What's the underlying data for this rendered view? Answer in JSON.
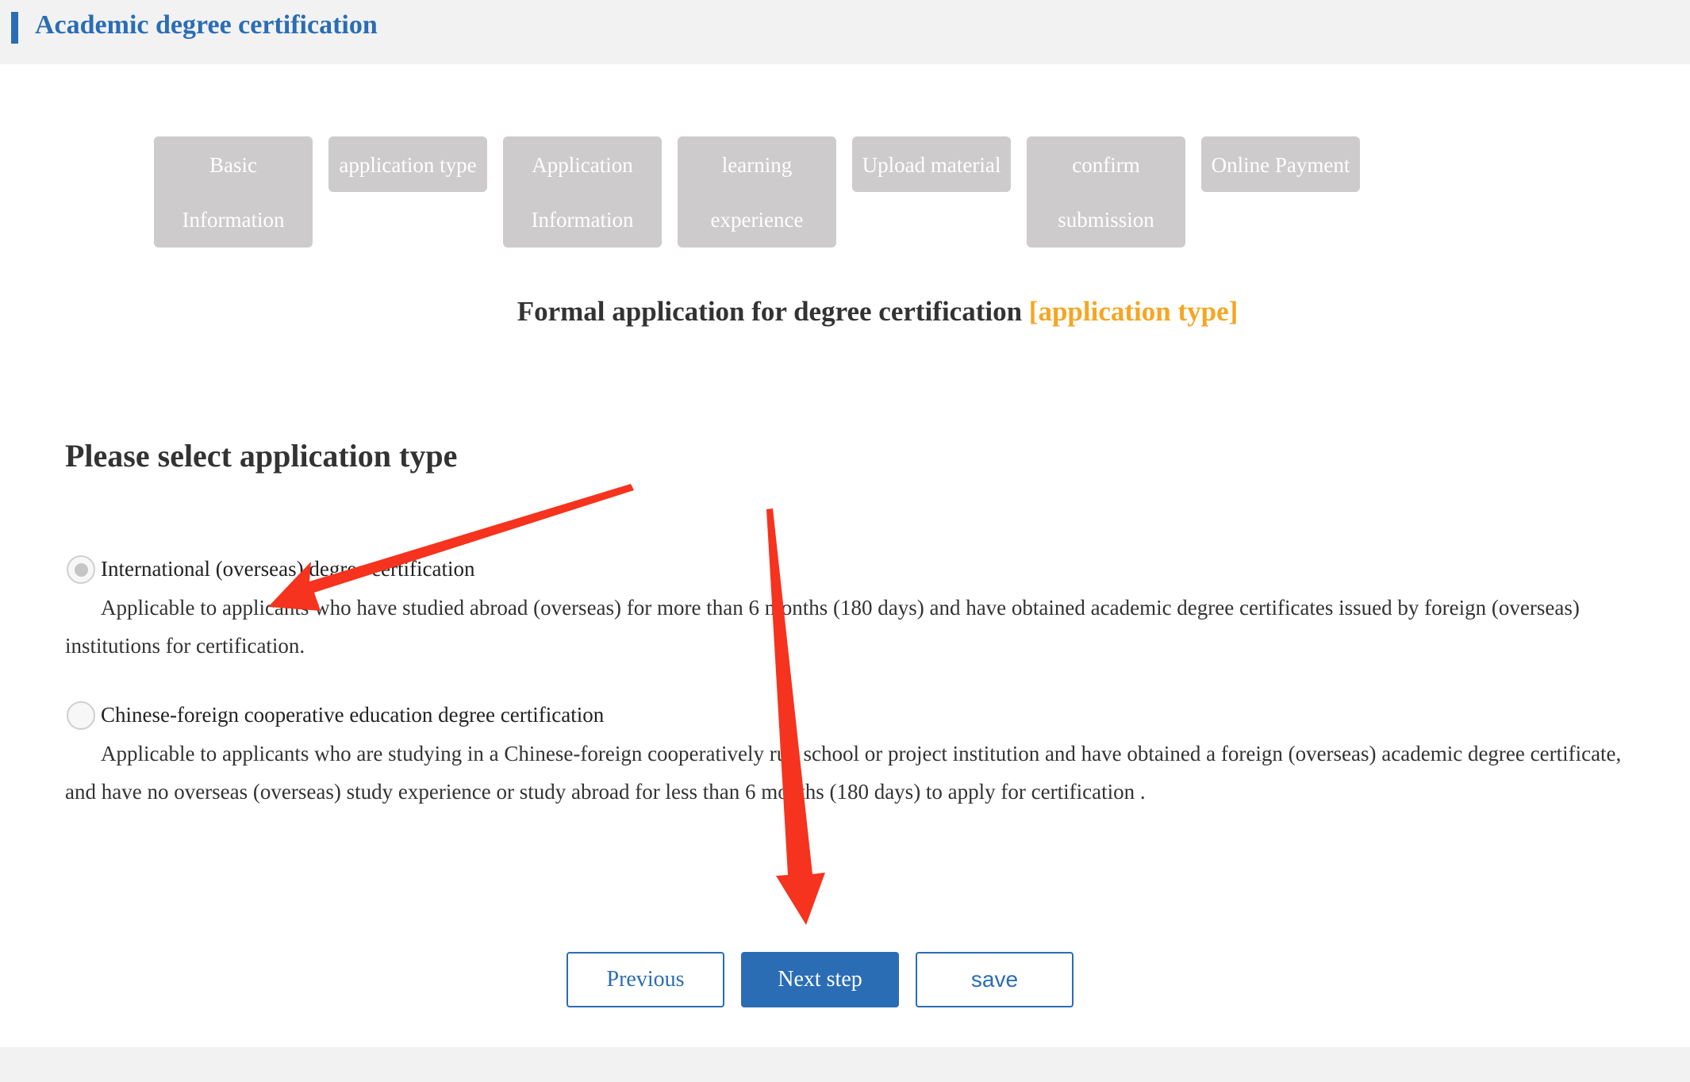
{
  "header": {
    "title": "Academic degree certification",
    "accent_color": "#2a6db5"
  },
  "steps": [
    {
      "line1": "Basic",
      "line2": "Information"
    },
    {
      "line1": "application type",
      "line2": ""
    },
    {
      "line1": "Application",
      "line2": "Information"
    },
    {
      "line1": "learning",
      "line2": "experience"
    },
    {
      "line1": "Upload material",
      "line2": ""
    },
    {
      "line1": "confirm",
      "line2": "submission"
    },
    {
      "line1": "Online Payment",
      "line2": ""
    }
  ],
  "section": {
    "title": "Formal application for degree certification",
    "current_step": "[application type]",
    "accent_color": "#f5a623"
  },
  "selection": {
    "heading": "Please select application type",
    "options": [
      {
        "label": "International (overseas) degree certification",
        "description": "Applicable to applicants who have studied abroad (overseas) for more than 6 months (180 days) and have obtained academic degree certificates issued by foreign (overseas) institutions for certification.",
        "selected": true
      },
      {
        "label": "Chinese-foreign cooperative education degree certification",
        "description": "Applicable to applicants who are studying in a Chinese-foreign cooperatively run school or project institution and have obtained a foreign (overseas) academic degree certificate, and have no overseas (overseas) study experience or study abroad for less than 6 months (180 days) to apply for certification .",
        "selected": false
      }
    ]
  },
  "buttons": {
    "previous": "Previous",
    "next": "Next step",
    "save": "save"
  },
  "annotation_color": "#f5331e"
}
